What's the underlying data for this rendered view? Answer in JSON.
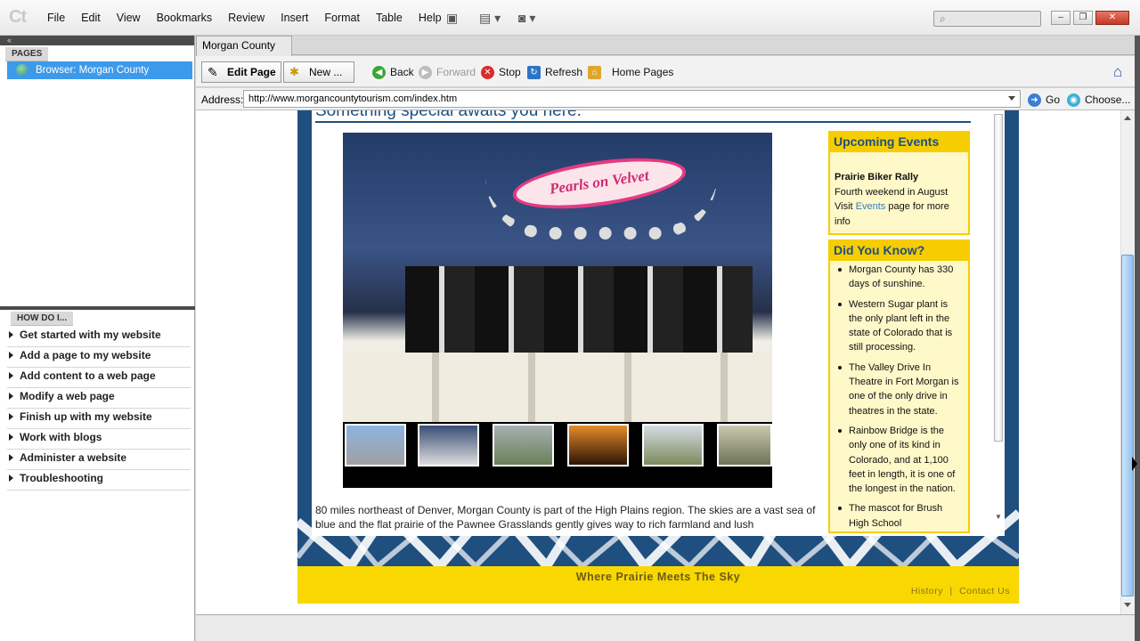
{
  "app": {
    "logo": "Ct",
    "menus": [
      "File",
      "Edit",
      "View",
      "Bookmarks",
      "Review",
      "Insert",
      "Format",
      "Table",
      "Help"
    ],
    "window_buttons": [
      "–",
      "❐",
      "✕"
    ]
  },
  "left_pane": {
    "pages_header": "PAGES",
    "selected_page": "Browser: Morgan County",
    "howdoi_header": "HOW DO I...",
    "howdoi_items": [
      "Get started with my website",
      "Add a page to my website",
      "Add content to a web page",
      "Modify a web page",
      "Finish up with my website",
      "Work with blogs",
      "Administer a website",
      "Troubleshooting"
    ]
  },
  "tab": {
    "title": "Morgan County"
  },
  "toolbar": {
    "edit_page": "Edit Page",
    "new": "New ...",
    "back": "Back",
    "forward": "Forward",
    "stop": "Stop",
    "refresh": "Refresh",
    "home_pages": "Home Pages"
  },
  "address": {
    "label": "Address:",
    "url": "http://www.morgancountytourism.com/index.htm",
    "go": "Go",
    "choose": "Choose..."
  },
  "site": {
    "slogan": "Something special awaits you here.",
    "photo_banner": "Pearls on Velvet",
    "intro": "80 miles northeast of Denver, Morgan County is part of the High Plains region. The skies are a vast sea of blue and the flat prairie of the Pawnee Grasslands gently gives way to rich farmland and lush",
    "events": {
      "heading": "Upcoming Events",
      "title": "Prairie Biker Rally",
      "line1": "Fourth weekend in August",
      "pre": "Visit ",
      "link": "Events",
      "post": " page for more info"
    },
    "dyk": {
      "heading": "Did You Know?",
      "items": [
        "Morgan County has 330 days of sunshine.",
        "Western Sugar plant is the only plant left in the state of Colorado that is still processing.",
        "The Valley Drive In Theatre in Fort Morgan is one of the only drive in theatres in the state.",
        "Rainbow Bridge is the only one of its kind in Colorado, and at 1,100 feet in length, it is one of the longest in the nation.",
        "The mascot for Brush High School (Beetdiggers) was"
      ]
    },
    "footer": {
      "tagline": "Where Prairie Meets The Sky",
      "link1": "History",
      "sep": "|",
      "link2": "Contact Us"
    }
  },
  "colors": {
    "site_blue": "#1f4f7f",
    "site_yellow": "#f8d800",
    "selection": "#3d9aeb"
  }
}
